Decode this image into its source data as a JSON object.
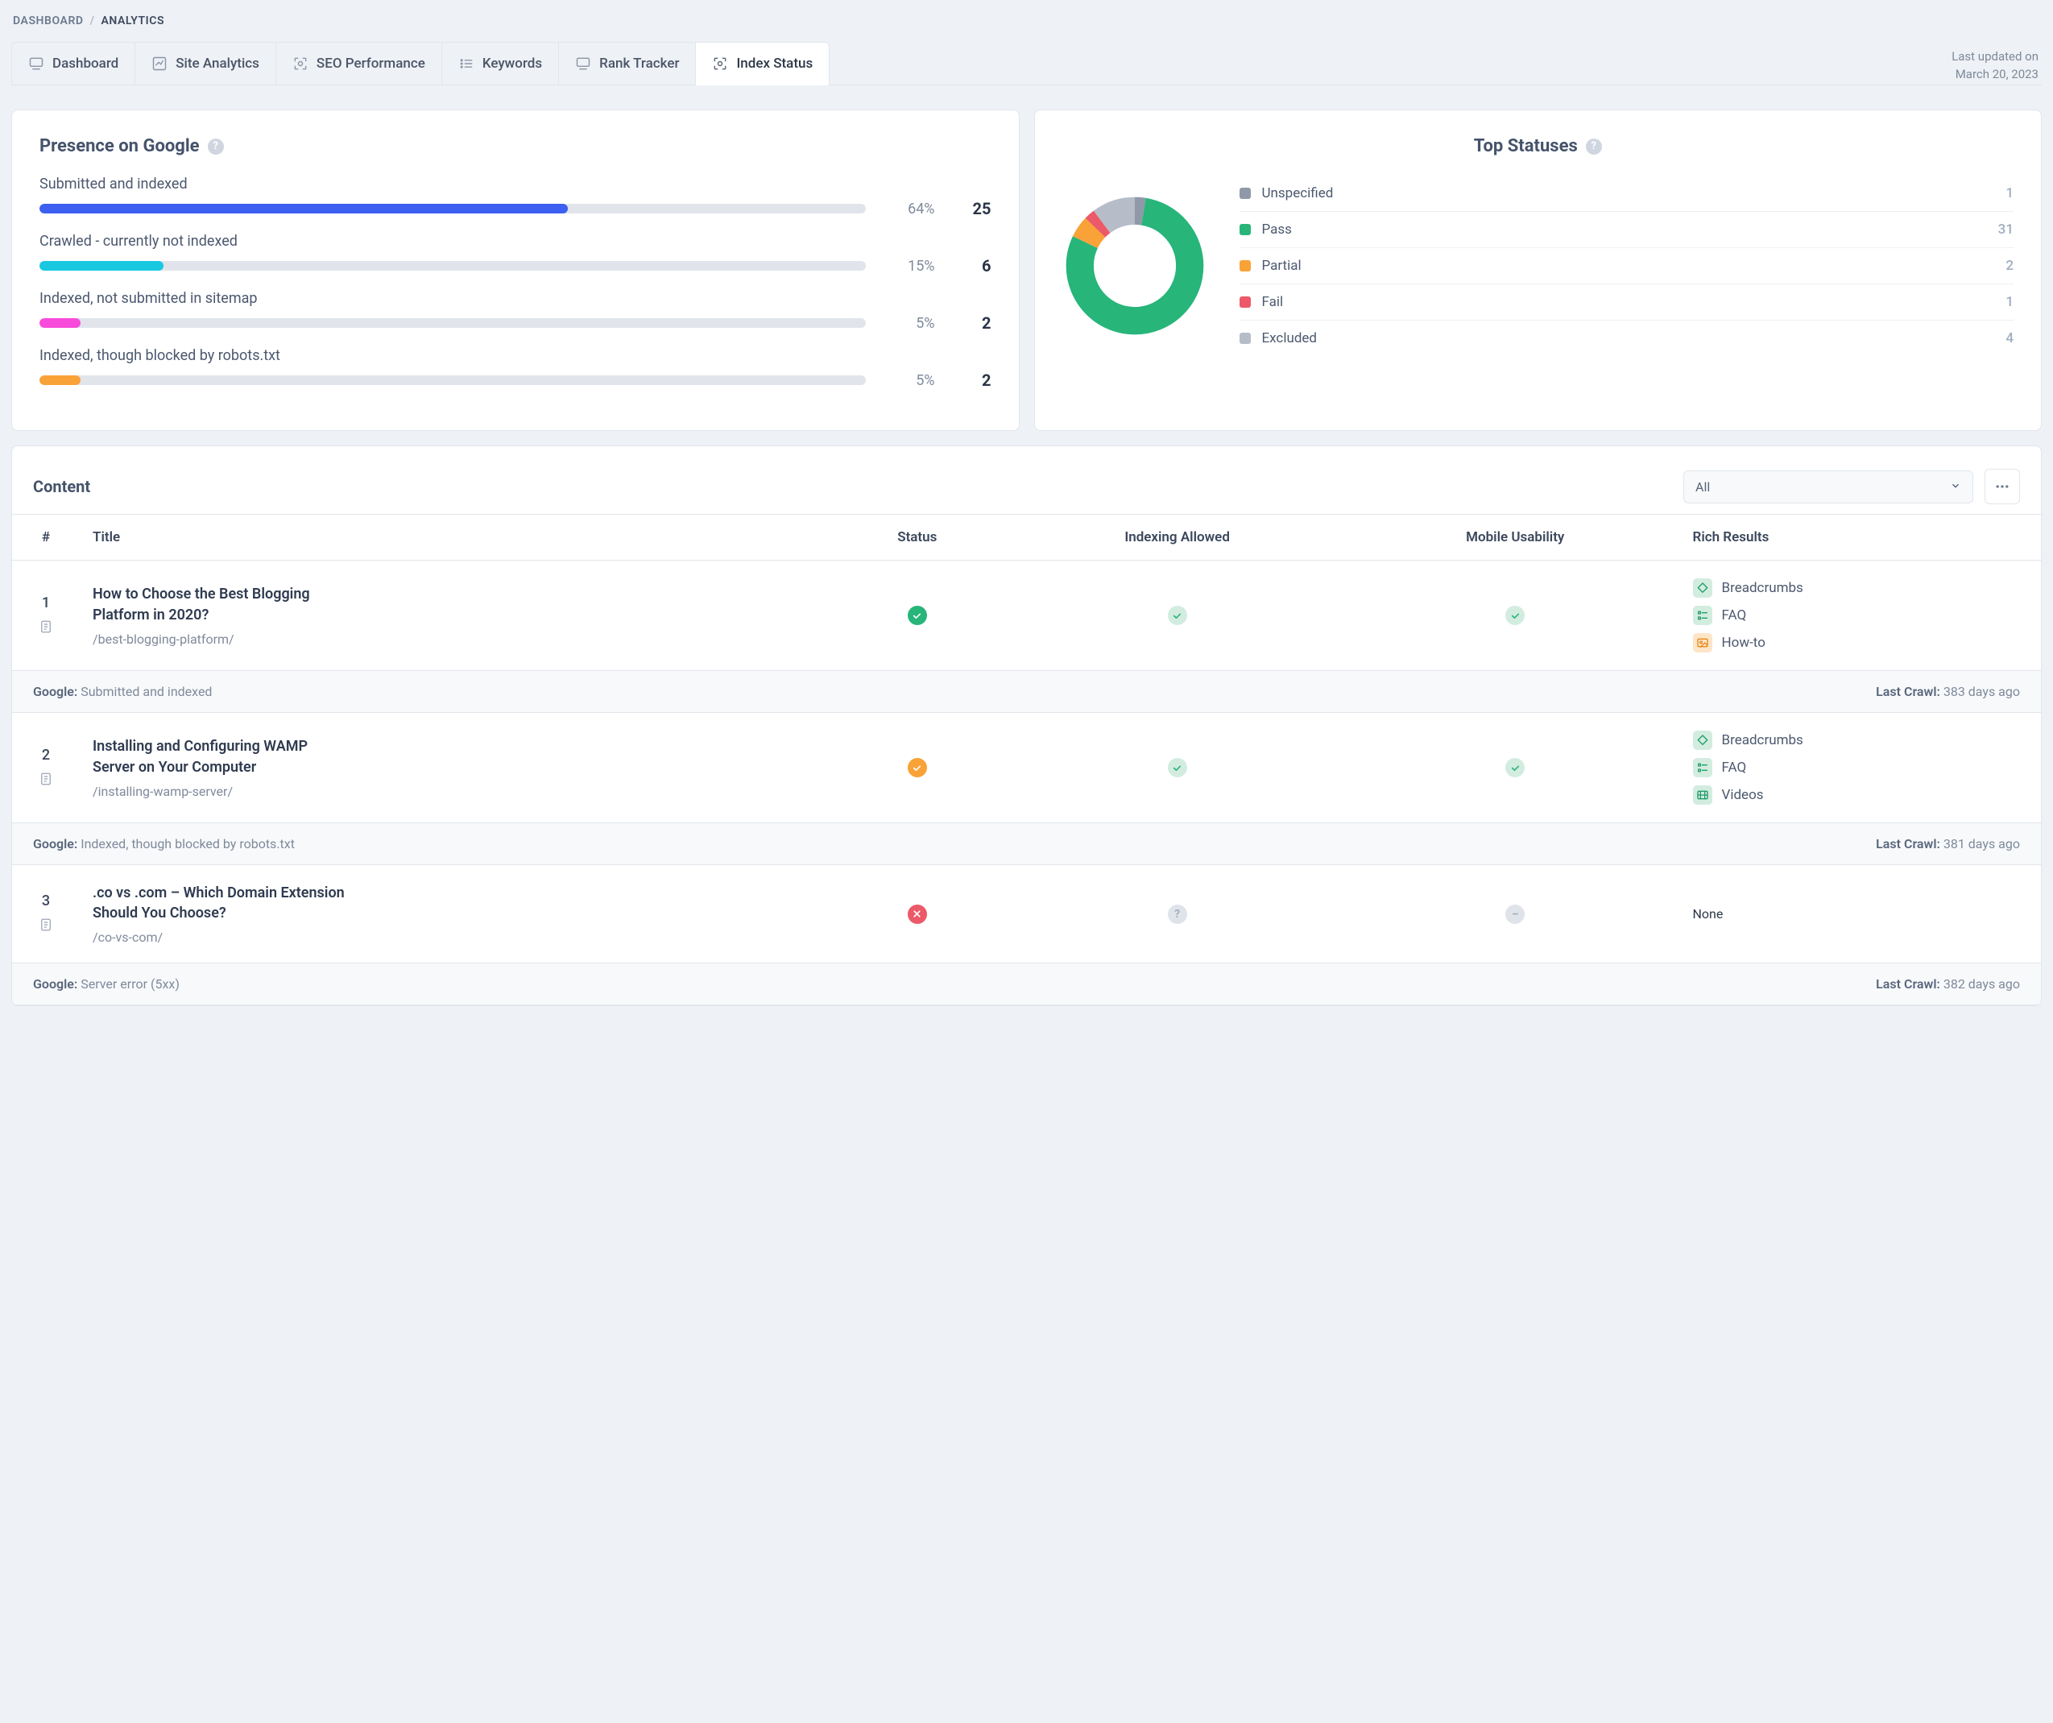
{
  "breadcrumb": {
    "root": "DASHBOARD",
    "sep": "/",
    "current": "ANALYTICS"
  },
  "tabs": [
    {
      "id": "tab-dashboard",
      "label": "Dashboard",
      "icon": "monitor"
    },
    {
      "id": "tab-site-analytics",
      "label": "Site Analytics",
      "icon": "chart"
    },
    {
      "id": "tab-seo-performance",
      "label": "SEO Performance",
      "icon": "scan"
    },
    {
      "id": "tab-keywords",
      "label": "Keywords",
      "icon": "list"
    },
    {
      "id": "tab-rank-tracker",
      "label": "Rank Tracker",
      "icon": "monitor"
    },
    {
      "id": "tab-index-status",
      "label": "Index Status",
      "icon": "scan",
      "active": true
    }
  ],
  "updated": {
    "line1": "Last updated on",
    "line2": "March 20, 2023"
  },
  "presence": {
    "title": "Presence on Google",
    "rows": [
      {
        "label": "Submitted and indexed",
        "pct": "64%",
        "pctNum": 64,
        "value": "25",
        "color": "#3c5ff1"
      },
      {
        "label": "Crawled - currently not indexed",
        "pct": "15%",
        "pctNum": 15,
        "value": "6",
        "color": "#18c8e0"
      },
      {
        "label": "Indexed, not submitted in sitemap",
        "pct": "5%",
        "pctNum": 5,
        "value": "2",
        "color": "#f84bdb"
      },
      {
        "label": "Indexed, though blocked by robots.txt",
        "pct": "5%",
        "pctNum": 5,
        "value": "2",
        "color": "#f9a238"
      }
    ]
  },
  "statuses": {
    "title": "Top Statuses",
    "items": [
      {
        "label": "Unspecified",
        "value": "1",
        "num": 1,
        "color": "#8f99a8"
      },
      {
        "label": "Pass",
        "value": "31",
        "num": 31,
        "color": "#27b57a"
      },
      {
        "label": "Partial",
        "value": "2",
        "num": 2,
        "color": "#f9a238"
      },
      {
        "label": "Fail",
        "value": "1",
        "num": 1,
        "color": "#ec5968"
      },
      {
        "label": "Excluded",
        "value": "4",
        "num": 4,
        "color": "#b6bdc9"
      }
    ]
  },
  "chart_data": {
    "type": "pie",
    "title": "Top Statuses",
    "series": [
      {
        "name": "count",
        "values": [
          1,
          31,
          2,
          1,
          4
        ]
      }
    ],
    "categories": [
      "Unspecified",
      "Pass",
      "Partial",
      "Fail",
      "Excluded"
    ],
    "colors": [
      "#8f99a8",
      "#27b57a",
      "#f9a238",
      "#ec5968",
      "#b6bdc9"
    ]
  },
  "content": {
    "title": "Content",
    "filter": {
      "selected": "All"
    },
    "columns": {
      "idx": "#",
      "title": "Title",
      "status": "Status",
      "indexing": "Indexing Allowed",
      "mobile": "Mobile Usability",
      "rich": "Rich Results"
    },
    "labels": {
      "google": "Google:",
      "lastCrawl": "Last Crawl:",
      "none": "None"
    },
    "rows": [
      {
        "num": "1",
        "title": "How to Choose the Best Blogging Platform in 2020?",
        "slug": "/best-blogging-platform/",
        "status": "green",
        "indexing": "soft-green",
        "mobile": "soft-green",
        "rich": [
          {
            "label": "Breadcrumbs",
            "icon": "diamond",
            "tone": "green"
          },
          {
            "label": "FAQ",
            "icon": "list",
            "tone": "green"
          },
          {
            "label": "How-to",
            "icon": "image",
            "tone": "orange"
          }
        ],
        "google": "Submitted and indexed",
        "crawl": "383 days ago"
      },
      {
        "num": "2",
        "title": "Installing and Configuring WAMP Server on Your Computer",
        "slug": "/installing-wamp-server/",
        "status": "orange",
        "indexing": "soft-green",
        "mobile": "soft-green",
        "rich": [
          {
            "label": "Breadcrumbs",
            "icon": "diamond",
            "tone": "green"
          },
          {
            "label": "FAQ",
            "icon": "list",
            "tone": "green"
          },
          {
            "label": "Videos",
            "icon": "video",
            "tone": "green"
          }
        ],
        "google": "Indexed, though blocked by robots.txt",
        "crawl": "381 days ago"
      },
      {
        "num": "3",
        "title": ".co vs .com – Which Domain Extension Should You Choose?",
        "slug": "/co-vs-com/",
        "status": "red",
        "indexing": "gray-q",
        "mobile": "gray-dash",
        "rich": "none",
        "google": "Server error (5xx)",
        "crawl": "382 days ago"
      }
    ]
  }
}
